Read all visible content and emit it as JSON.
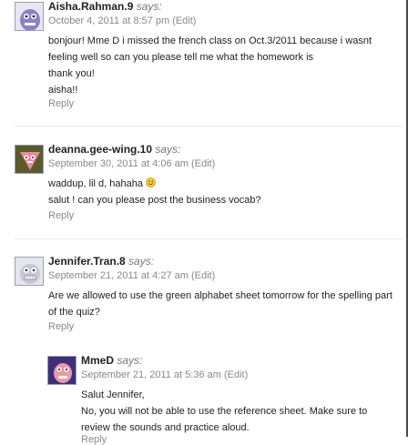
{
  "comments": [
    {
      "author": "Aisha.Rahman.9",
      "says": "says:",
      "date": "October 4, 2011 at 8:57 pm",
      "edit": "(Edit)",
      "lines": [
        "bonjour! Mme D i missed the french class on Oct.3/2011 because i wasnt",
        "feeling well so can you please tell me what the homework is",
        "thank you!",
        "aisha!!"
      ],
      "reply": "Reply"
    },
    {
      "author": "deanna.gee-wing.10",
      "says": "says:",
      "date": "September 30, 2011 at 4:06 am",
      "edit": "(Edit)",
      "lines": [
        "waddup, lil d, hahaha",
        "salut ! can you please post the business vocab?"
      ],
      "reply": "Reply"
    },
    {
      "author": "Jennifer.Tran.8",
      "says": "says:",
      "date": "September 21, 2011 at 4:27 am",
      "edit": "(Edit)",
      "lines": [
        "Are we allowed to use the green alphabet sheet tomorrow for the spelling part",
        "of the quiz?"
      ],
      "reply": "Reply"
    },
    {
      "author": "MmeD",
      "says": "says:",
      "date": "September 21, 2011 at 5:36 am",
      "edit": "(Edit)",
      "lines": [
        "Salut Jennifer,",
        "No, you will not be able to use the reference sheet. Make sure to",
        "review the sounds and practice aloud."
      ],
      "reply": "Reply"
    }
  ],
  "icons": {
    "smiley": "smiley-emoticon-icon"
  },
  "colors": {
    "author": "#222222",
    "meta": "#888888",
    "text": "#222222",
    "separator": "#e6e6e6"
  }
}
